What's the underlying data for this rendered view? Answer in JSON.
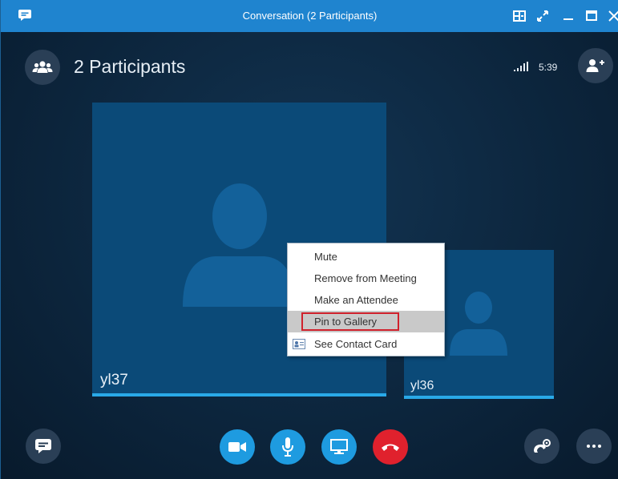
{
  "window": {
    "title": "Conversation (2 Participants)",
    "accent": "#1f84cf"
  },
  "header": {
    "participants_label": "2 Participants",
    "call_duration": "5:39"
  },
  "stage": {
    "participants": [
      {
        "name": "yl37"
      },
      {
        "name": "yl36"
      }
    ]
  },
  "context_menu": {
    "items": [
      {
        "label": "Mute",
        "state": "normal"
      },
      {
        "label": "Remove from Meeting",
        "state": "normal"
      },
      {
        "label": "Make an Attendee",
        "state": "normal"
      },
      {
        "label": "Pin to Gallery",
        "state": "hovered",
        "annotation": "red outline"
      },
      {
        "label": "See Contact Card",
        "state": "normal",
        "icon": "contact-card-icon"
      }
    ]
  },
  "call_controls": {
    "buttons": [
      {
        "icon": "video-camera-icon",
        "color": "#1e9be0"
      },
      {
        "icon": "microphone-icon",
        "color": "#1e9be0"
      },
      {
        "icon": "screen-share-icon",
        "color": "#1e9be0"
      },
      {
        "icon": "hang-up-icon",
        "color": "#e0212d"
      }
    ]
  },
  "icons": {
    "app": "skype-chat-icon",
    "participants": "group-people-icon",
    "signal": "signal-strength-icon",
    "invite": "add-person-icon",
    "chat": "chat-bubble-icon",
    "call_options": "phone-settings-icon",
    "more": "more-options-icon"
  }
}
